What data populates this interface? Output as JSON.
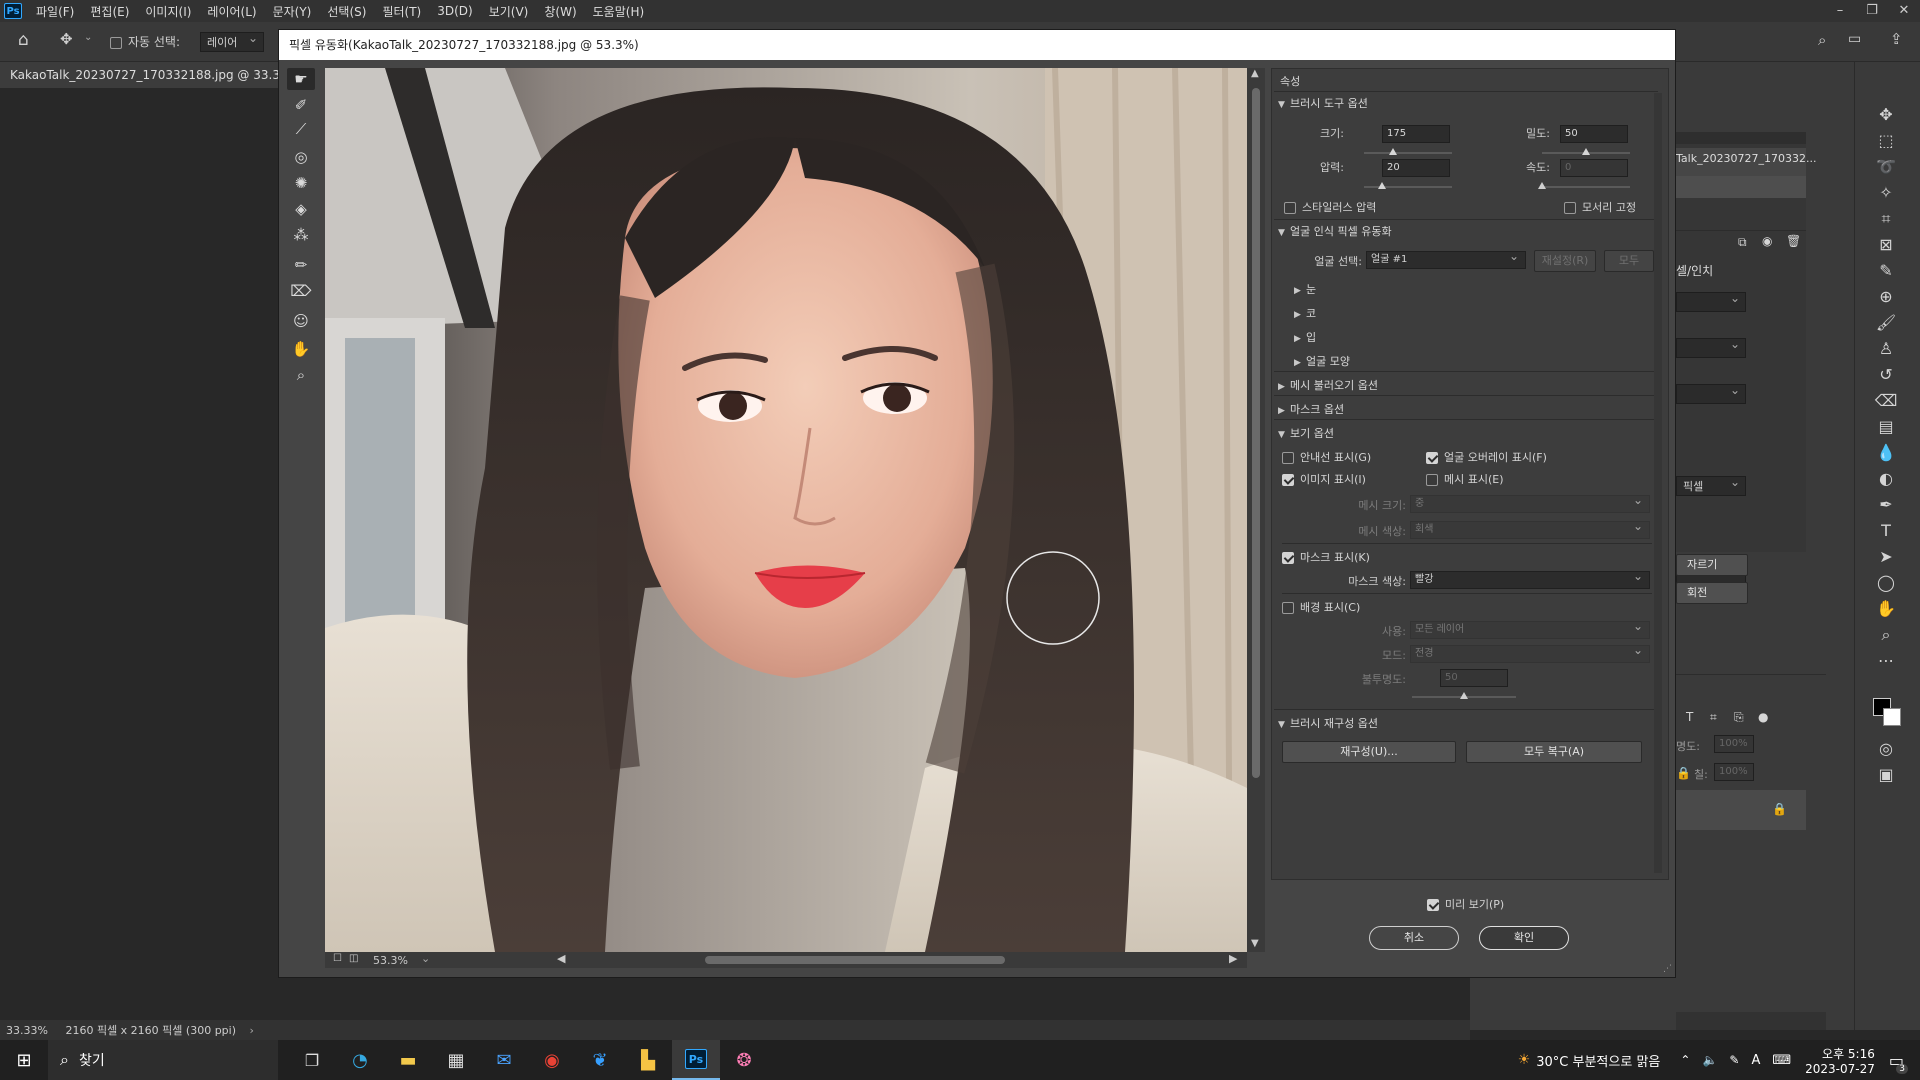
{
  "menubar": {
    "app": "Ps",
    "items": [
      "파일(F)",
      "편집(E)",
      "이미지(I)",
      "레이어(L)",
      "문자(Y)",
      "선택(S)",
      "필터(T)",
      "3D(D)",
      "보기(V)",
      "창(W)",
      "도움말(H)"
    ]
  },
  "options": {
    "auto_select_label": "자동 선택:",
    "layer_select": "레이어"
  },
  "document": {
    "tab_title": "KakaoTalk_20230727_170332188.jpg @ 33.3% (RGB",
    "status_zoom": "33.33%",
    "status_info": "2160 픽셀 x 2160 픽셀 (300 ppi)"
  },
  "dialog": {
    "title": "픽셀 유동화(KakaoTalk_20230727_170332188.jpg @ 53.3%)",
    "zoom": "53.3%",
    "properties_title": "속성",
    "brush": {
      "section": "브러시 도구 옵션",
      "size_label": "크기:",
      "size": "175",
      "density_label": "밀도:",
      "density": "50",
      "pressure_label": "압력:",
      "pressure": "20",
      "rate_label": "속도:",
      "rate": "0",
      "stylus_label": "스타일러스 압력",
      "pin_edges_label": "모서리 고정",
      "size_level": 0.33,
      "density_level": 0.5,
      "pressure_level": 0.2,
      "rate_level": 0
    },
    "face": {
      "section": "얼굴 인식 픽셀 유동화",
      "select_label": "얼굴 선택:",
      "select_value": "얼굴 #1",
      "reset_button": "재설정(R)",
      "all_button": "모두",
      "items": [
        "눈",
        "코",
        "입",
        "얼굴 모양"
      ]
    },
    "mesh_load_section": "메시 불러오기 옵션",
    "mask_section": "마스크 옵션",
    "view": {
      "section": "보기 옵션",
      "guides": "안내선 표시(G)",
      "face_overlay": "얼굴 오버레이 표시(F)",
      "image": "이미지 표시(I)",
      "mesh": "메시 표시(E)",
      "mesh_size_label": "메시 크기:",
      "mesh_size": "중",
      "mesh_color_label": "메시 색상:",
      "mesh_color": "회색",
      "mask_show": "마스크 표시(K)",
      "mask_color_label": "마스크 색상:",
      "mask_color": "빨강",
      "backdrop": "배경 표시(C)",
      "use_label": "사용:",
      "use": "모든 레이어",
      "mode_label": "모드:",
      "mode": "전경",
      "opacity_label": "불투명도:",
      "opacity": "50",
      "opacity_level": 0.5
    },
    "reconstruct": {
      "section": "브러시 재구성 옵션",
      "reconstruct_button": "재구성(U)...",
      "restore_all_button": "모두 복구(A)"
    },
    "preview_label": "미리 보기(P)",
    "cancel": "취소",
    "ok": "확인"
  },
  "right_panel": {
    "layer_name": "Talk_20230727_170332...",
    "section_label": "셀/인치",
    "pixel_label": "픽셀",
    "crop_label": "자르기",
    "rotate_label": "회전",
    "opacity_label": "명도:",
    "opacity_value": "100%",
    "fill_label": "칠:",
    "fill_value": "100%"
  },
  "taskbar": {
    "search": "찾기",
    "weather": "30°C 부분적으로 맑음",
    "time": "오후 5:16",
    "date": "2023-07-27",
    "notif_count": "3"
  },
  "colors": {
    "accent": "#31a8ff",
    "mask_red": "#e83a3a"
  }
}
